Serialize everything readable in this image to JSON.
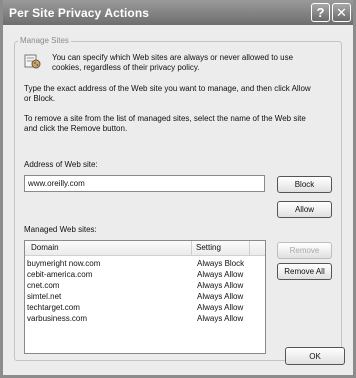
{
  "window": {
    "title": "Per Site Privacy Actions",
    "help_glyph": "?",
    "close_glyph": "✕"
  },
  "manage_sites": {
    "group_label": "Manage Sites",
    "intro_line1": "You can specify which Web sites are always or never allowed to use",
    "intro_line2": "cookies, regardless of their privacy policy.",
    "instructions_line1": "Type the exact address of the Web site you want to manage, and then click Allow",
    "instructions_line2": "or Block.",
    "remove_line1": "To remove a site from the list of managed sites, select the name of the Web site",
    "remove_line2": "and click the Remove button.",
    "address_label": "Address of Web site:",
    "address_value": "www.oreilly.com",
    "block_label": "Block",
    "allow_label": "Allow",
    "managed_label": "Managed Web sites:",
    "remove_label": "Remove",
    "remove_all_label": "Remove All"
  },
  "table": {
    "columns": [
      "Domain",
      "Setting"
    ],
    "rows": [
      [
        "buymeright now.com",
        "Always Block"
      ],
      [
        "cebit-america.com",
        "Always Allow"
      ],
      [
        "cnet.com",
        "Always Allow"
      ],
      [
        "simtel.net",
        "Always Allow"
      ],
      [
        "techtarget.com",
        "Always Allow"
      ],
      [
        "varbusiness.com",
        "Always Allow"
      ]
    ]
  },
  "footer": {
    "ok_label": "OK"
  },
  "icons": {
    "info": "cookie-info-icon",
    "help": "help-icon",
    "close": "close-icon"
  }
}
